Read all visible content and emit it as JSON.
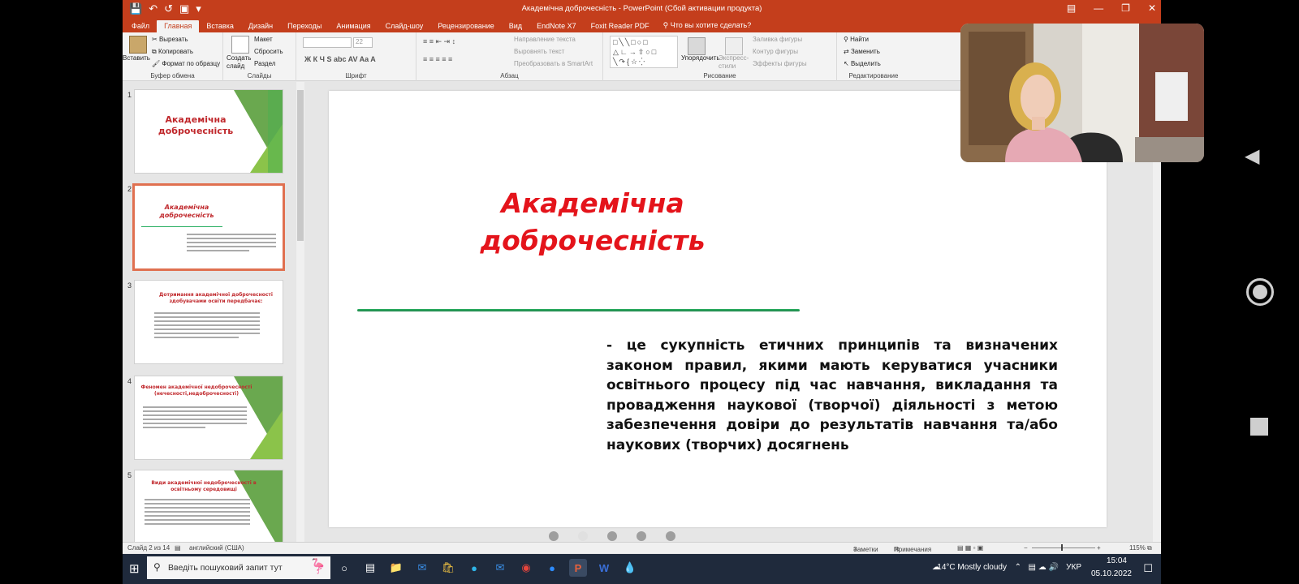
{
  "titlebar": {
    "title": "Академічна доброчесність - PowerPoint (Сбой активации продукта)"
  },
  "tabs": [
    {
      "label": "Файл"
    },
    {
      "label": "Главная",
      "active": true
    },
    {
      "label": "Вставка"
    },
    {
      "label": "Дизайн"
    },
    {
      "label": "Переходы"
    },
    {
      "label": "Анимация"
    },
    {
      "label": "Слайд-шоу"
    },
    {
      "label": "Рецензирование"
    },
    {
      "label": "Вид"
    },
    {
      "label": "EndNote X7"
    },
    {
      "label": "Foxit Reader PDF"
    }
  ],
  "tell_me": "Что вы хотите сделать?",
  "ribbon": {
    "clipboard": {
      "paste": "Вставить",
      "cut": "Вырезать",
      "copy": "Копировать",
      "format_painter": "Формат по образцу",
      "label": "Буфер обмена"
    },
    "slides": {
      "new_slide": "Создать слайд",
      "layout": "Макет",
      "reset": "Сбросить",
      "section": "Раздел",
      "label": "Слайды"
    },
    "font": {
      "label": "Шрифт",
      "size": "22",
      "buttons": "Ж К Ч S abc AV Aa A"
    },
    "paragraph": {
      "text_direction": "Направление текста",
      "align_text": "Выровнять текст",
      "smartart": "Преобразовать в SmartArt",
      "label": "Абзац"
    },
    "drawing": {
      "arrange": "Упорядочить",
      "quick_styles": "Экспресс-стили",
      "shape_fill": "Заливка фигуры",
      "shape_outline": "Контур фигуры",
      "shape_effects": "Эффекты фигуры",
      "label": "Рисование"
    },
    "editing": {
      "find": "Найти",
      "replace": "Заменить",
      "select": "Выделить",
      "label": "Редактирование"
    }
  },
  "thumbnails": [
    {
      "num": "1",
      "title": "Академічна доброчесність"
    },
    {
      "num": "2",
      "title": "Академічна доброчесність"
    },
    {
      "num": "3",
      "title": "Дотримання академічної доброчесності здобувачами освіти передбачає:"
    },
    {
      "num": "4",
      "title": "Феномен академічної недоброчесності (нечесності,недоброчесності)"
    },
    {
      "num": "5",
      "title": "Види академічної недоброчесності в освітньому середовищі"
    }
  ],
  "slide": {
    "title_line1": "Академічна",
    "title_line2": "доброчесність",
    "body": "- це сукупність етичних принципів та визначених законом правил, якими мають керуватися учасники освітнього процесу під час навчання, викладання та провадження наукової (творчої) діяльності з метою забезпечення довіри до результатів навчання та/або наукових (творчих) досягнень"
  },
  "status": {
    "slide_of": "Слайд 2 из 14",
    "language": "английский (США)",
    "notes": "Заметки",
    "comments": "Примечания",
    "zoom": "115%"
  },
  "taskbar": {
    "search_placeholder": "Введіть пошуковий запит тут",
    "weather": "14°C  Mostly cloudy",
    "lang": "УКР",
    "time": "15:04",
    "date": "05.10.2022"
  },
  "colors": {
    "ppt_accent": "#c43e1c",
    "title_red": "#e4141b",
    "line_green": "#27ae60"
  }
}
